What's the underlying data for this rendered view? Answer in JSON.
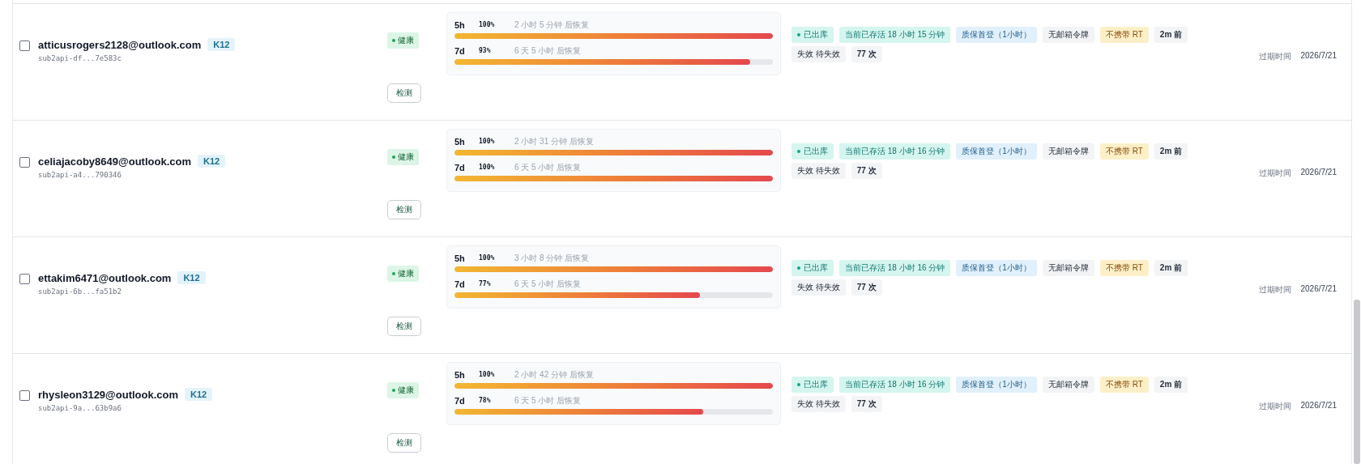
{
  "accounts": [
    {
      "checked": false,
      "email": "atticusrogers2128@outlook.com",
      "plan": "K12",
      "key": "sub2api-df...7e583c",
      "status": {
        "kind": "healthy",
        "label": "健康"
      },
      "check_button": "检测",
      "usage": [
        {
          "window": "5h",
          "percent": "100%",
          "reset": "2 小时 5 分钟 后恢复",
          "level": 1
        },
        {
          "window": "7d",
          "percent": "93%",
          "reset": "6 天 5 小时 后恢复",
          "level": 0.93
        }
      ],
      "tags": [
        {
          "kind": "dot",
          "label": "已出库"
        },
        {
          "kind": "teal",
          "label": "当前已存活 18 小时 15 分钟"
        },
        {
          "kind": "blue",
          "label": "质保首登（1小时）"
        },
        {
          "kind": "plain",
          "label": "无邮箱令牌"
        },
        {
          "kind": "warn",
          "label": "不携带 RT"
        },
        {
          "kind": "strong",
          "label": "2m 前"
        },
        {
          "kind": "plain",
          "label": "失效 待失效"
        },
        {
          "kind": "strong",
          "label": "77 次"
        }
      ],
      "expiry_label": "过期时间",
      "expiry_date": "2026/7/21"
    },
    {
      "checked": false,
      "email": "celiajacoby8649@outlook.com",
      "plan": "K12",
      "key": "sub2api-a4...790346",
      "status": {
        "kind": "healthy",
        "label": "健康"
      },
      "check_button": "检测",
      "usage": [
        {
          "window": "5h",
          "percent": "100%",
          "reset": "2 小时 31 分钟 后恢复",
          "level": 1
        },
        {
          "window": "7d",
          "percent": "100%",
          "reset": "6 天 5 小时 后恢复",
          "level": 1
        }
      ],
      "tags": [
        {
          "kind": "dot",
          "label": "已出库"
        },
        {
          "kind": "teal",
          "label": "当前已存活 18 小时 16 分钟"
        },
        {
          "kind": "blue",
          "label": "质保首登（1小时）"
        },
        {
          "kind": "plain",
          "label": "无邮箱令牌"
        },
        {
          "kind": "warn",
          "label": "不携带 RT"
        },
        {
          "kind": "strong",
          "label": "2m 前"
        },
        {
          "kind": "plain",
          "label": "失效 待失效"
        },
        {
          "kind": "strong",
          "label": "77 次"
        }
      ],
      "expiry_label": "过期时间",
      "expiry_date": "2026/7/21"
    },
    {
      "checked": false,
      "email": "ettakim6471@outlook.com",
      "plan": "K12",
      "key": "sub2api-6b...fa51b2",
      "status": {
        "kind": "healthy",
        "label": "健康"
      },
      "check_button": "检测",
      "usage": [
        {
          "window": "5h",
          "percent": "100%",
          "reset": "3 小时 8 分钟 后恢复",
          "level": 1
        },
        {
          "window": "7d",
          "percent": "77%",
          "reset": "6 天 5 小时 后恢复",
          "level": 0.77
        }
      ],
      "tags": [
        {
          "kind": "dot",
          "label": "已出库"
        },
        {
          "kind": "teal",
          "label": "当前已存活 18 小时 16 分钟"
        },
        {
          "kind": "blue",
          "label": "质保首登（1小时）"
        },
        {
          "kind": "plain",
          "label": "无邮箱令牌"
        },
        {
          "kind": "warn",
          "label": "不携带 RT"
        },
        {
          "kind": "strong",
          "label": "2m 前"
        },
        {
          "kind": "plain",
          "label": "失效 待失效"
        },
        {
          "kind": "strong",
          "label": "77 次"
        }
      ],
      "expiry_label": "过期时间",
      "expiry_date": "2026/7/21"
    },
    {
      "checked": false,
      "email": "rhysleon3129@outlook.com",
      "plan": "K12",
      "key": "sub2api-9a...63b9a6",
      "status": {
        "kind": "healthy",
        "label": "健康"
      },
      "check_button": "检测",
      "usage": [
        {
          "window": "5h",
          "percent": "100%",
          "reset": "2 小时 42 分钟 后恢复",
          "level": 1
        },
        {
          "window": "7d",
          "percent": "78%",
          "reset": "6 天 5 小时 后恢复",
          "level": 0.78
        }
      ],
      "tags": [
        {
          "kind": "dot",
          "label": "已出库"
        },
        {
          "kind": "teal",
          "label": "当前已存活 18 小时 16 分钟"
        },
        {
          "kind": "blue",
          "label": "质保首登（1小时）"
        },
        {
          "kind": "plain",
          "label": "无邮箱令牌"
        },
        {
          "kind": "warn",
          "label": "不携带 RT"
        },
        {
          "kind": "strong",
          "label": "2m 前"
        },
        {
          "kind": "plain",
          "label": "失效 待失效"
        },
        {
          "kind": "strong",
          "label": "77 次"
        }
      ],
      "expiry_label": "过期时间",
      "expiry_date": "2026/7/21"
    }
  ]
}
